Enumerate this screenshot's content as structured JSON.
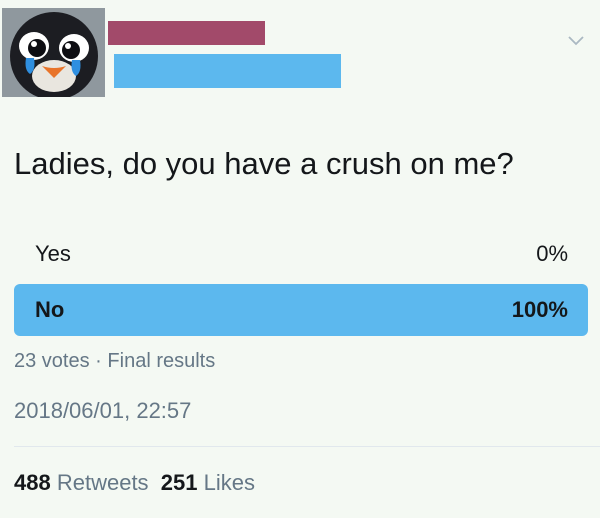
{
  "tweet": {
    "avatar_icon": "penguin-avatar-icon",
    "name_redaction_color": "#a24a6a",
    "handle_redaction_color": "#5cb8ee",
    "menu_icon": "chevron-down-icon",
    "question": "Ladies, do you have a crush on me?"
  },
  "poll": {
    "options": [
      {
        "label": "Yes",
        "percent": "0%",
        "fraction": 0.0
      },
      {
        "label": "No",
        "percent": "100%",
        "fraction": 1.0
      }
    ],
    "votes": "23 votes",
    "separator": "·",
    "status": "Final results",
    "accent_color": "#5cb8ee"
  },
  "timestamp": "2018/06/01, 22:57",
  "stats": {
    "retweets_count": "488",
    "retweets_label": "Retweets",
    "likes_count": "251",
    "likes_label": "Likes"
  }
}
